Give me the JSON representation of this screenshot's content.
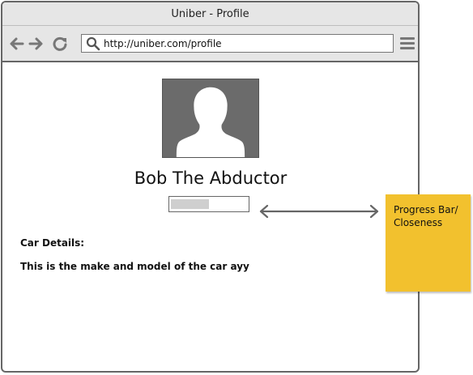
{
  "window": {
    "title": "Uniber - Profile"
  },
  "browser": {
    "url": "http://uniber.com/profile",
    "icons": [
      "back-arrow-icon",
      "forward-arrow-icon",
      "reload-icon",
      "search-icon",
      "menu-icon"
    ]
  },
  "profile": {
    "name": "Bob The Abductor",
    "closeness_fraction": 0.5,
    "car_label": "Car Details:",
    "car_description": "This is the make and model of the car ayy"
  },
  "annotation": {
    "line1": "Progress Bar/",
    "line2": "Closeness",
    "color": "#f2c12e"
  }
}
